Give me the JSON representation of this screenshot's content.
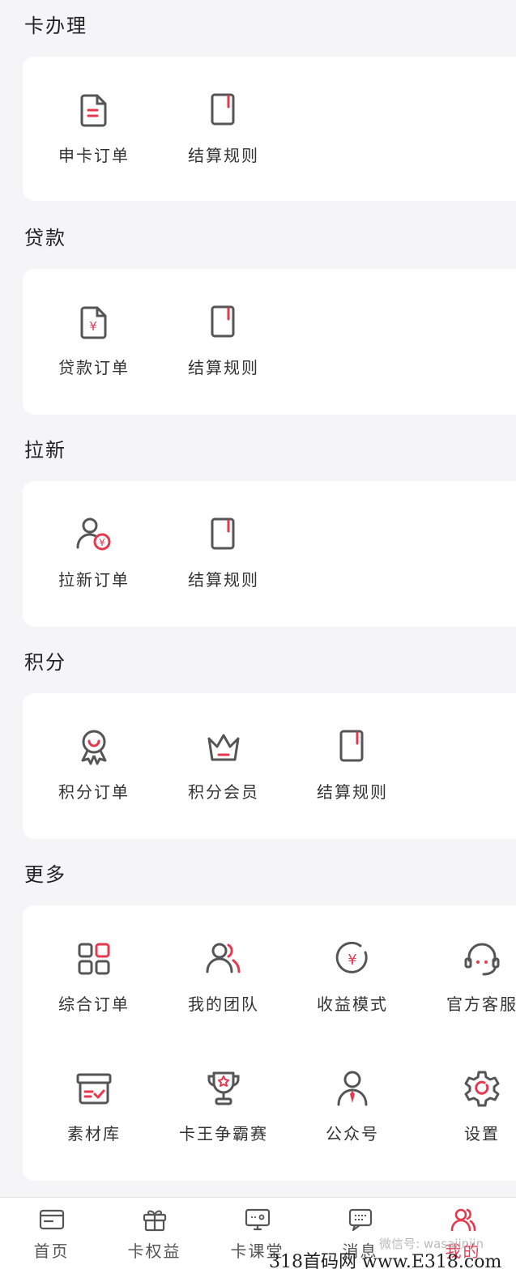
{
  "colors": {
    "accent": "#e53950",
    "icon_stroke": "#555555",
    "background": "#f5f5f7",
    "card": "#ffffff"
  },
  "sections": [
    {
      "title": "卡办理",
      "items": [
        {
          "label": "申卡订单",
          "icon": "document-icon"
        },
        {
          "label": "结算规则",
          "icon": "book-icon"
        }
      ]
    },
    {
      "title": "贷款",
      "items": [
        {
          "label": "贷款订单",
          "icon": "yuan-document-icon"
        },
        {
          "label": "结算规则",
          "icon": "book-icon"
        }
      ]
    },
    {
      "title": "拉新",
      "items": [
        {
          "label": "拉新订单",
          "icon": "user-yuan-icon"
        },
        {
          "label": "结算规则",
          "icon": "book-icon"
        }
      ]
    },
    {
      "title": "积分",
      "items": [
        {
          "label": "积分订单",
          "icon": "medal-icon"
        },
        {
          "label": "积分会员",
          "icon": "crown-icon"
        },
        {
          "label": "结算规则",
          "icon": "book-icon"
        }
      ]
    },
    {
      "title": "更多",
      "items": [
        {
          "label": "综合订单",
          "icon": "grid-icon"
        },
        {
          "label": "我的团队",
          "icon": "team-icon"
        },
        {
          "label": "收益模式",
          "icon": "yuan-circle-icon"
        },
        {
          "label": "官方客服",
          "icon": "headset-icon"
        },
        {
          "label": "素材库",
          "icon": "box-icon"
        },
        {
          "label": "卡王争霸赛",
          "icon": "trophy-icon"
        },
        {
          "label": "公众号",
          "icon": "person-tie-icon"
        },
        {
          "label": "设置",
          "icon": "gear-icon"
        }
      ]
    }
  ],
  "tabbar": [
    {
      "label": "首页",
      "icon": "home-card-icon"
    },
    {
      "label": "卡权益",
      "icon": "gift-icon"
    },
    {
      "label": "卡课堂",
      "icon": "monitor-icon"
    },
    {
      "label": "消息",
      "icon": "message-icon"
    },
    {
      "label": "我的",
      "icon": "profile-icon",
      "active": true
    }
  ],
  "watermark": "微信号: wasajinjin",
  "footer_mark": "318首码网 www.E318.com"
}
